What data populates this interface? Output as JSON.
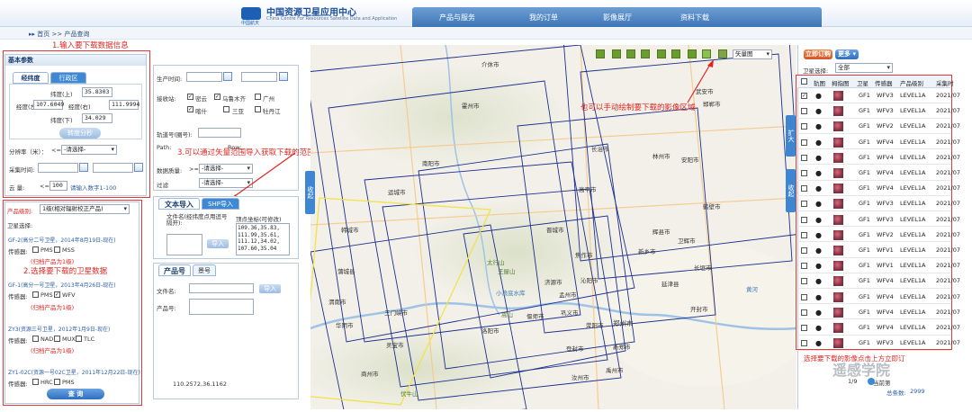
{
  "header": {
    "logo_text": "中国资源卫星应用中心",
    "logo_sub": "China Centre For Resources Satellite Data and Application",
    "logo_abbr": "中国航天",
    "nav": [
      "产品与服务",
      "我的订单",
      "影像展厅",
      "资料下载"
    ]
  },
  "breadcrumb": "▸▸ 首页 >> 产品查询",
  "annotations": {
    "a1": "1.输入要下载数据信息",
    "a2": "2.选择要下载的卫星数据",
    "a3": "3.可以通过矢量范围导入获取下载的范围",
    "a4": "也可以手动绘制要下载的影像区域",
    "a5": "选择要下载的影像点击上方立即订"
  },
  "basic": {
    "title": "基本参数",
    "tab_extent": "经纬度",
    "tab_admin": "行政区",
    "lat_top_label": "纬度(上)",
    "lat_top": "35.8303",
    "lon_left_label": "经度(左)",
    "lon_left": "107.6049",
    "lon_right_label": "经度(右)",
    "lon_right": "111.9994",
    "lat_bottom_label": "纬度(下)",
    "lat_bottom": "34.029",
    "convert_btn": "转度分秒",
    "resolution_label": "分辨率（米）：",
    "resolution_op": "<=",
    "resolution_value": "-请选择-",
    "date_label": "采集时间:",
    "cloud_label": "云 量:",
    "cloud_op": "<=",
    "cloud_value": "100",
    "cloud_hint": "请输入数字1-100"
  },
  "product": {
    "type_label": "产品级别:",
    "type_value": "1级(相对辐射校正产品)",
    "sat_label": "卫星选择:",
    "groups": [
      {
        "name": "GF-2(高分二号卫星，2014年8月19日-现在)",
        "sensor_label": "传感器:",
        "sensors": [
          "PMS",
          "MSS"
        ],
        "checked": [
          false,
          false
        ],
        "note": "(归档产品为1级)"
      },
      {
        "name": "GF-1(高分一号卫星，2013年4月26日-现在)",
        "sensor_label": "传感器:",
        "sensors": [
          "PMS",
          "WFV"
        ],
        "checked": [
          false,
          true
        ],
        "note": "(归档产品为1级)"
      },
      {
        "name": "ZY3(资源三号卫星，2012年1月9日-现在)",
        "sensor_label": "传感器:",
        "sensors": [
          "NAD",
          "MUX",
          "TLC"
        ],
        "checked": [
          false,
          false,
          false
        ],
        "note": "(归档产品为1级)"
      },
      {
        "name": "ZY1-02C(资源一号02C卫星，2011年12月22日-现在)",
        "sensor_label": "传感器:",
        "sensors": [
          "HRC",
          "PMS"
        ],
        "checked": [
          false,
          false
        ],
        "note": ""
      }
    ],
    "query_btn": "查 询"
  },
  "middle": {
    "production_time_label": "生产时间:",
    "station_label": "接收站:",
    "stations": [
      "密云",
      "乌鲁木齐",
      "广州",
      "喀什",
      "三亚",
      "牡丹江"
    ],
    "stations_checked": [
      true,
      true,
      false,
      true,
      false,
      false
    ],
    "orbit_label": "轨道号(圈号):",
    "path_label": "Path:",
    "row_label": "Row:",
    "quality_label": "数据质量:",
    "quality_op": ">=",
    "quality_value": "-请选择-",
    "filter_label": "过滤",
    "filter_value": "-请选择-",
    "import_tab_text": "文本导入",
    "import_tab_shp": "SHP导入",
    "file_label": "文件名(经纬度点用逗号隔开):",
    "vertex_label": "顶点坐标(可修改)",
    "vertices": "109.36,35.83,\n111.99,35.61,\n111.12,34.02,\n107.60,35.04",
    "import_btn": "导入",
    "product_tab": "产品号",
    "scene_tab": "景号",
    "file_name_label": "文件名:",
    "product_no_label": "产品号:",
    "import_btn2": "导入",
    "coord_readout": "110.2572,36.1162"
  },
  "map": {
    "layer_select": "矢量图",
    "collapse_tab": "收起",
    "expand_tab": "扩大",
    "collapse_tab2": "收起",
    "cities": [
      {
        "name": "介休市"
      },
      {
        "name": "霍州市"
      },
      {
        "name": "武安市"
      },
      {
        "name": "邯郸市"
      },
      {
        "name": "南阳市"
      },
      {
        "name": "长治市"
      },
      {
        "name": "林州市"
      },
      {
        "name": "安阳市"
      },
      {
        "name": "高平市"
      },
      {
        "name": "鹤壁市"
      },
      {
        "name": "韩城市"
      },
      {
        "name": "晋城市"
      },
      {
        "name": "辉县市"
      },
      {
        "name": "卫辉市"
      },
      {
        "name": "焦作市"
      },
      {
        "name": "新乡市"
      },
      {
        "name": "济源市"
      },
      {
        "name": "孟州市"
      },
      {
        "name": "沁阳市"
      },
      {
        "name": "巩义市"
      },
      {
        "name": "三门峡市"
      },
      {
        "name": "偃师市"
      },
      {
        "name": "郑州市"
      },
      {
        "name": "新郑市"
      },
      {
        "name": "洛阳市"
      },
      {
        "name": "渭南市"
      },
      {
        "name": "华阴市"
      },
      {
        "name": "灵宝市"
      },
      {
        "name": "商州市"
      },
      {
        "name": "登封市"
      },
      {
        "name": "汝州市"
      },
      {
        "name": "禹州市"
      },
      {
        "name": "开封市"
      },
      {
        "name": "长垣市"
      },
      {
        "name": "延津县"
      },
      {
        "name": "蒲城县"
      },
      {
        "name": "太行山"
      },
      {
        "name": "王屋山"
      },
      {
        "name": "嵩山"
      },
      {
        "name": "伏牛山"
      },
      {
        "name": "小浪底水库"
      },
      {
        "name": "运城市"
      },
      {
        "name": "荥阳市"
      },
      {
        "name": "黄河"
      }
    ]
  },
  "orders": {
    "order_btn": "立即订购",
    "more_btn": "更多 ▾",
    "sat_filter_label": "卫星选择:",
    "sat_filter_value": "全部",
    "columns": [
      "",
      "轨图",
      "拇指图",
      "卫星",
      "传感器",
      "产品级别",
      "采集时"
    ],
    "rows": [
      {
        "checked": true,
        "sat": "GF1",
        "sensor": "WFV3",
        "level": "LEVEL1A",
        "time": "2021/07"
      },
      {
        "checked": false,
        "sat": "GF1",
        "sensor": "WFV3",
        "level": "LEVEL1A",
        "time": "2021/07"
      },
      {
        "checked": false,
        "sat": "GF1",
        "sensor": "WFV2",
        "level": "LEVEL1A",
        "time": "2021/07"
      },
      {
        "checked": false,
        "sat": "GF1",
        "sensor": "WFV4",
        "level": "LEVEL1A",
        "time": "2021/07"
      },
      {
        "checked": false,
        "sat": "GF1",
        "sensor": "WFV4",
        "level": "LEVEL1A",
        "time": "2021/07"
      },
      {
        "checked": false,
        "sat": "GF1",
        "sensor": "WFV4",
        "level": "LEVEL1A",
        "time": "2021/07"
      },
      {
        "checked": false,
        "sat": "GF1",
        "sensor": "WFV4",
        "level": "LEVEL1A",
        "time": "2021/07"
      },
      {
        "checked": false,
        "sat": "GF1",
        "sensor": "WFV3",
        "level": "LEVEL1A",
        "time": "2021/07"
      },
      {
        "checked": false,
        "sat": "GF1",
        "sensor": "WFV3",
        "level": "LEVEL1A",
        "time": "2021/07"
      },
      {
        "checked": false,
        "sat": "GF1",
        "sensor": "WFV2",
        "level": "LEVEL1A",
        "time": "2021/07"
      },
      {
        "checked": false,
        "sat": "GF1",
        "sensor": "WFV1",
        "level": "LEVEL1A",
        "time": "2021/07"
      },
      {
        "checked": false,
        "sat": "GF1",
        "sensor": "WFV1",
        "level": "LEVEL1A",
        "time": "2021/07"
      },
      {
        "checked": false,
        "sat": "GF1",
        "sensor": "WFV4",
        "level": "LEVEL1A",
        "time": "2021/07"
      },
      {
        "checked": false,
        "sat": "GF1",
        "sensor": "WFV4",
        "level": "LEVEL1A",
        "time": "2021/07"
      },
      {
        "checked": false,
        "sat": "GF1",
        "sensor": "WFV4",
        "level": "LEVEL1A",
        "time": "2021/07"
      },
      {
        "checked": false,
        "sat": "GF1",
        "sensor": "WFV4",
        "level": "LEVEL1A",
        "time": "2021/07"
      },
      {
        "checked": false,
        "sat": "GF1",
        "sensor": "WFV3",
        "level": "LEVEL1A",
        "time": "2021/07"
      }
    ],
    "page_label": "1/9",
    "current_page": "当前第",
    "total_label": "总条数:",
    "total_value": "2999"
  },
  "watermark": "遥感学院",
  "colors": {
    "accent": "#3e88d4",
    "annotation": "#e0261f",
    "footprint": "#1c2f8f",
    "aoi": "#f2e24a"
  }
}
